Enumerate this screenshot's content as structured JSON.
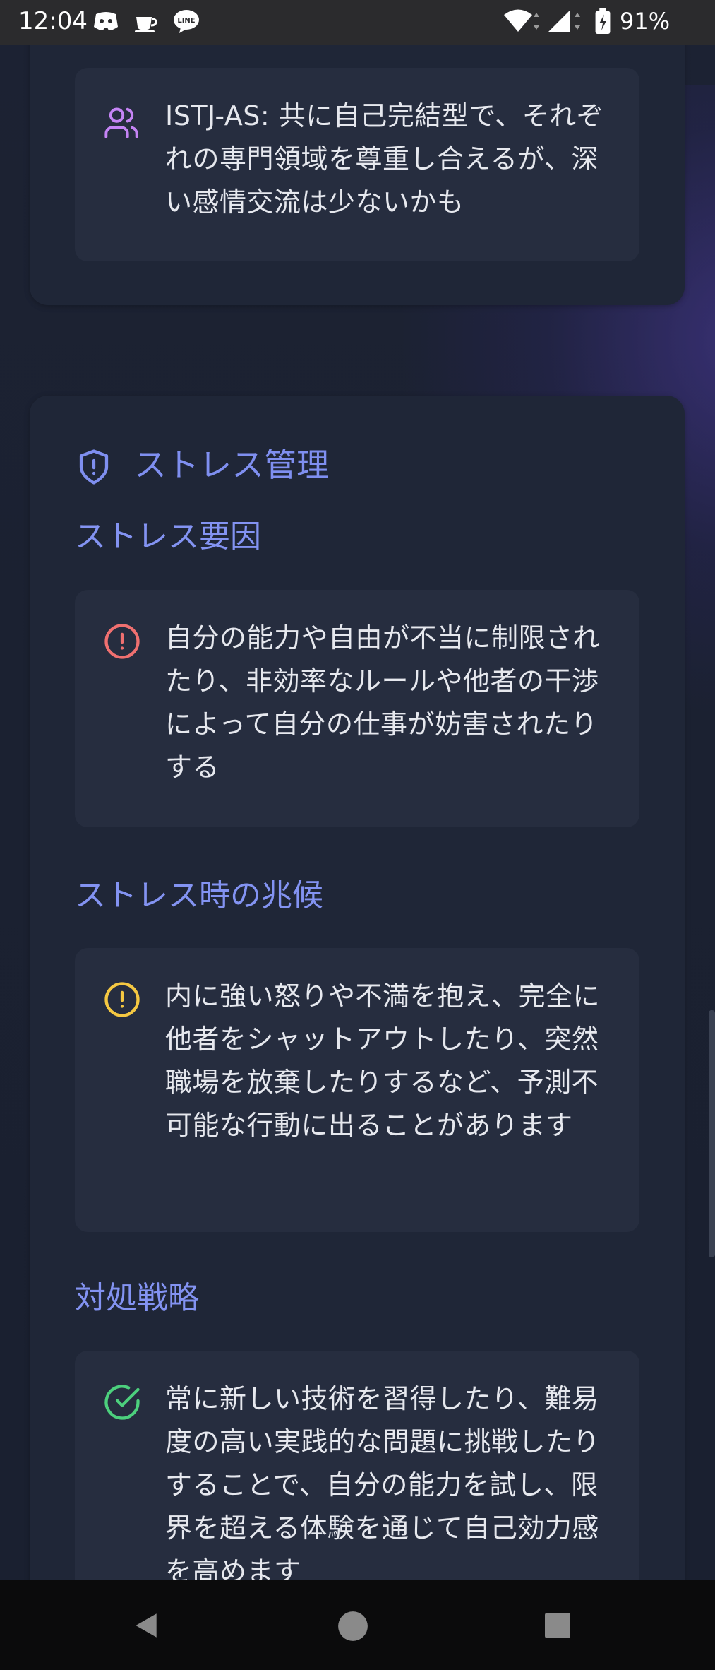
{
  "status_bar": {
    "time": "12:04",
    "battery": "91%",
    "icons": [
      "discord-icon",
      "coffee-icon",
      "line-icon",
      "wifi-icon",
      "signal-icon",
      "battery-icon"
    ]
  },
  "compat_card": {
    "item_text": "ISTJ-AS: 共に自己完結型で、それぞれの専門領域を尊重し合えるが、深い感情交流は少ないかも",
    "icon": "users-icon"
  },
  "stress_card": {
    "title": "ストレス管理",
    "title_icon": "shield-icon",
    "sections": [
      {
        "heading": "ストレス要因",
        "icon": "alert-circle-icon",
        "icon_color": "#f07070",
        "text": "自分の能力や自由が不当に制限されたり、非効率なルールや他者の干渉によって自分の仕事が妨害されたりする"
      },
      {
        "heading": "ストレス時の兆候",
        "icon": "alert-circle-icon",
        "icon_color": "#f5c842",
        "text": "内に強い怒りや不満を抱え、完全に他者をシャットアウトしたり、突然職場を放棄したりするなど、予測不可能な行動に出ることがあります"
      },
      {
        "heading": "対処戦略",
        "icon": "check-circle-icon",
        "icon_color": "#4cd07d",
        "text": "常に新しい技術を習得したり、難易度の高い実践的な問題に挑戦したりすることで、自分の能力を試し、限界を超える体験を通じて自己効力感を高めます"
      }
    ]
  },
  "colors": {
    "accent": "#7f8ff0",
    "background": "#1b2131",
    "card": "#1f2637",
    "inner_card": "#262d3f"
  },
  "nav_bar": {
    "buttons": [
      "back-button",
      "home-button",
      "recents-button"
    ]
  }
}
